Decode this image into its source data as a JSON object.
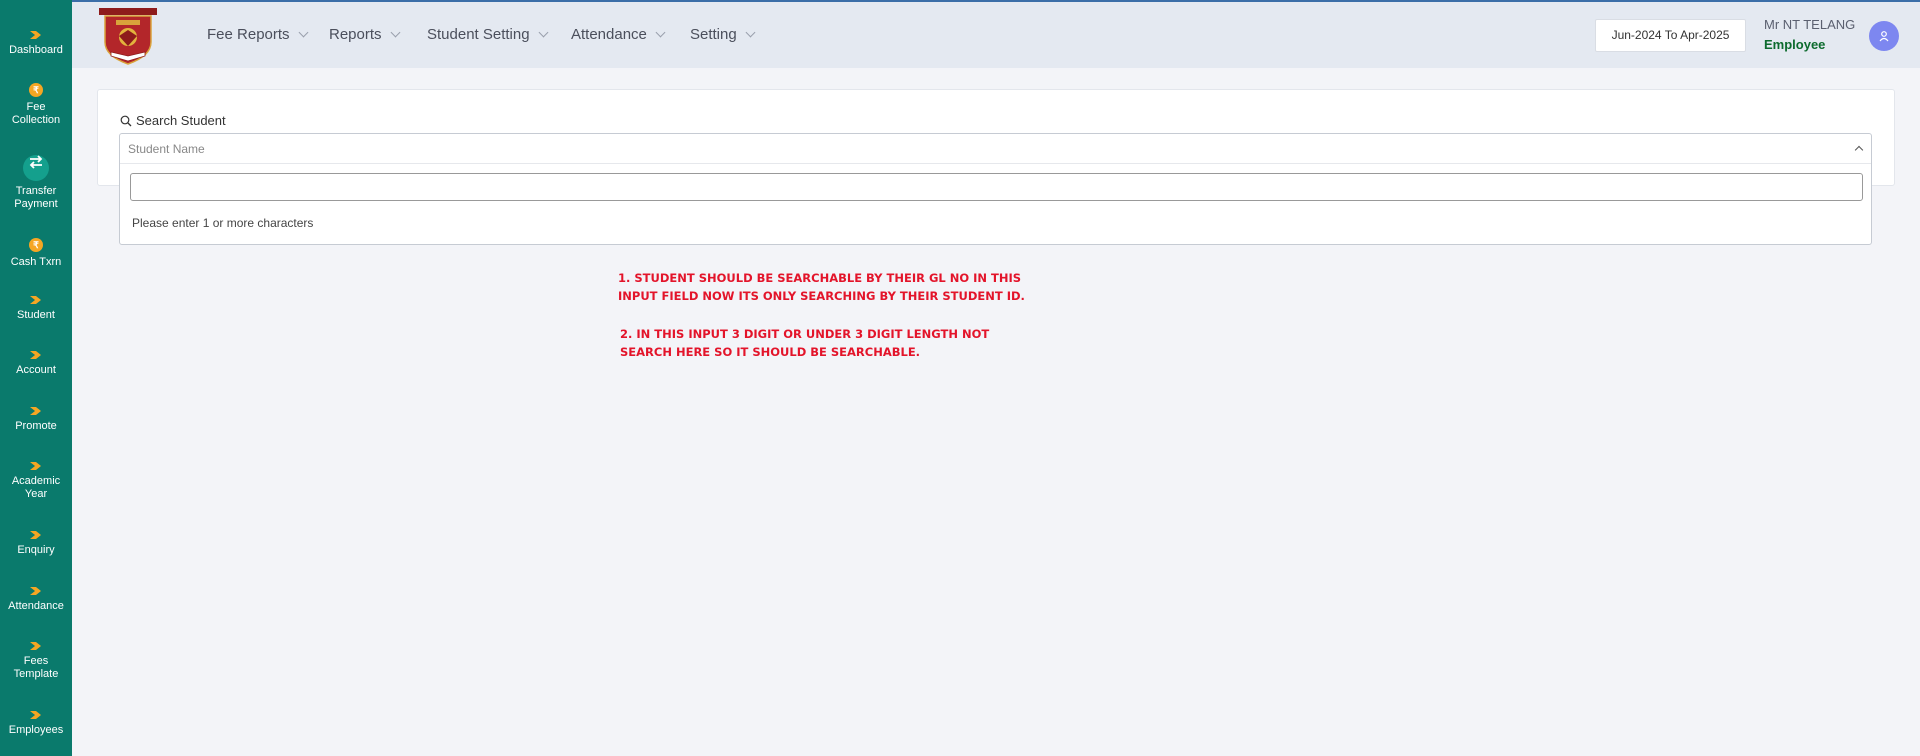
{
  "sidebar": {
    "items": [
      {
        "label": "Dashboard",
        "icon": "chevron-right-icon"
      },
      {
        "label": "Fee Collection",
        "icon": "coin-icon"
      },
      {
        "label": "Transfer Payment",
        "icon": "swap-arrows-icon"
      },
      {
        "label": "Cash Txrn",
        "icon": "coin-icon"
      },
      {
        "label": "Student",
        "icon": "chevron-right-icon"
      },
      {
        "label": "Account",
        "icon": "chevron-right-icon"
      },
      {
        "label": "Promote",
        "icon": "chevron-right-icon"
      },
      {
        "label": "Academic Year",
        "icon": "chevron-right-icon"
      },
      {
        "label": "Enquiry",
        "icon": "chevron-right-icon"
      },
      {
        "label": "Attendance",
        "icon": "chevron-right-icon"
      },
      {
        "label": "Fees Template",
        "icon": "chevron-right-icon"
      },
      {
        "label": "Employees",
        "icon": "chevron-right-icon"
      }
    ],
    "coin_symbol": "₹"
  },
  "header": {
    "nav": [
      {
        "label": "Fee Reports"
      },
      {
        "label": "Reports"
      },
      {
        "label": "Student Setting"
      },
      {
        "label": "Attendance"
      },
      {
        "label": "Setting"
      }
    ],
    "academic_year": "Jun-2024 To Apr-2025",
    "user_name": "Mr NT TELANG",
    "user_role": "Employee"
  },
  "search": {
    "label": "Search Student",
    "placeholder": "Student Name",
    "input_value": "",
    "message": "Please enter 1 or more characters"
  },
  "annotation": {
    "line1": "1. STUDENT SHOULD BE SEARCHABLE BY THEIR GL NO IN THIS",
    "line2": "INPUT FIELD NOW ITS ONLY SEARCHING BY THEIR STUDENT ID.",
    "line3": "2. IN THIS  INPUT 3 DIGIT OR UNDER 3 DIGIT LENGTH NOT",
    "line4": "SEARCH HERE SO IT SHOULD BE SEARCHABLE."
  },
  "colors": {
    "sidebar": "#0a7a6c",
    "accent_orange": "#f5a623",
    "header_bg": "#e4e9f1",
    "annotation_red": "#e3142a",
    "role_green": "#0d6b2e",
    "avatar": "#7d87f0"
  }
}
